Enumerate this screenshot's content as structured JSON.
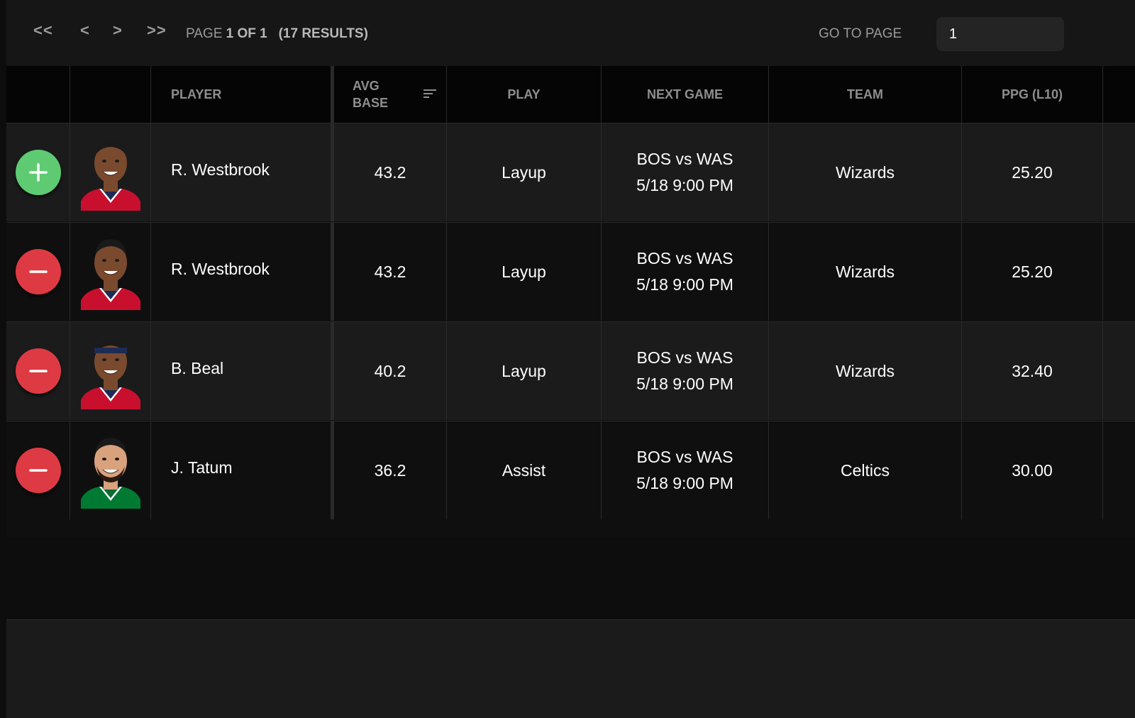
{
  "pager": {
    "first": "<<",
    "prev": "<",
    "next": ">",
    "last": ">>",
    "page_label": "PAGE",
    "page_value": "1 OF 1",
    "results": "(17 RESULTS)",
    "goto_label": "GO TO PAGE",
    "goto_value": "1"
  },
  "columns": {
    "player": "PLAYER",
    "avg_base_1": "AVG",
    "avg_base_2": "BASE",
    "play": "PLAY",
    "next_game": "NEXT GAME",
    "team": "TEAM",
    "ppg": "PPG (L10)"
  },
  "rows": [
    {
      "action": "add",
      "action_icon": "plus-icon",
      "player": "R. Westbrook",
      "avg_base": "43.2",
      "play": "Layup",
      "game_line1": "BOS vs WAS",
      "game_line2": "5/18 9:00 PM",
      "team": "Wizards",
      "ppg": "25.20",
      "jersey_color": "#c8102e"
    },
    {
      "action": "remove",
      "action_icon": "minus-icon",
      "player": "R. Westbrook",
      "avg_base": "43.2",
      "play": "Layup",
      "game_line1": "BOS vs WAS",
      "game_line2": "5/18 9:00 PM",
      "team": "Wizards",
      "ppg": "25.20",
      "jersey_color": "#c8102e"
    },
    {
      "action": "remove",
      "action_icon": "minus-icon",
      "player": "B. Beal",
      "avg_base": "40.2",
      "play": "Layup",
      "game_line1": "BOS vs WAS",
      "game_line2": "5/18 9:00 PM",
      "team": "Wizards",
      "ppg": "32.40",
      "jersey_color": "#c8102e"
    },
    {
      "action": "remove",
      "action_icon": "minus-icon",
      "player": "J. Tatum",
      "avg_base": "36.2",
      "play": "Assist",
      "game_line1": "BOS vs WAS",
      "game_line2": "5/18 9:00 PM",
      "team": "Celtics",
      "ppg": "30.00",
      "jersey_color": "#007a33"
    }
  ],
  "colors": {
    "add": "#5ecb73",
    "remove": "#de3a44"
  }
}
